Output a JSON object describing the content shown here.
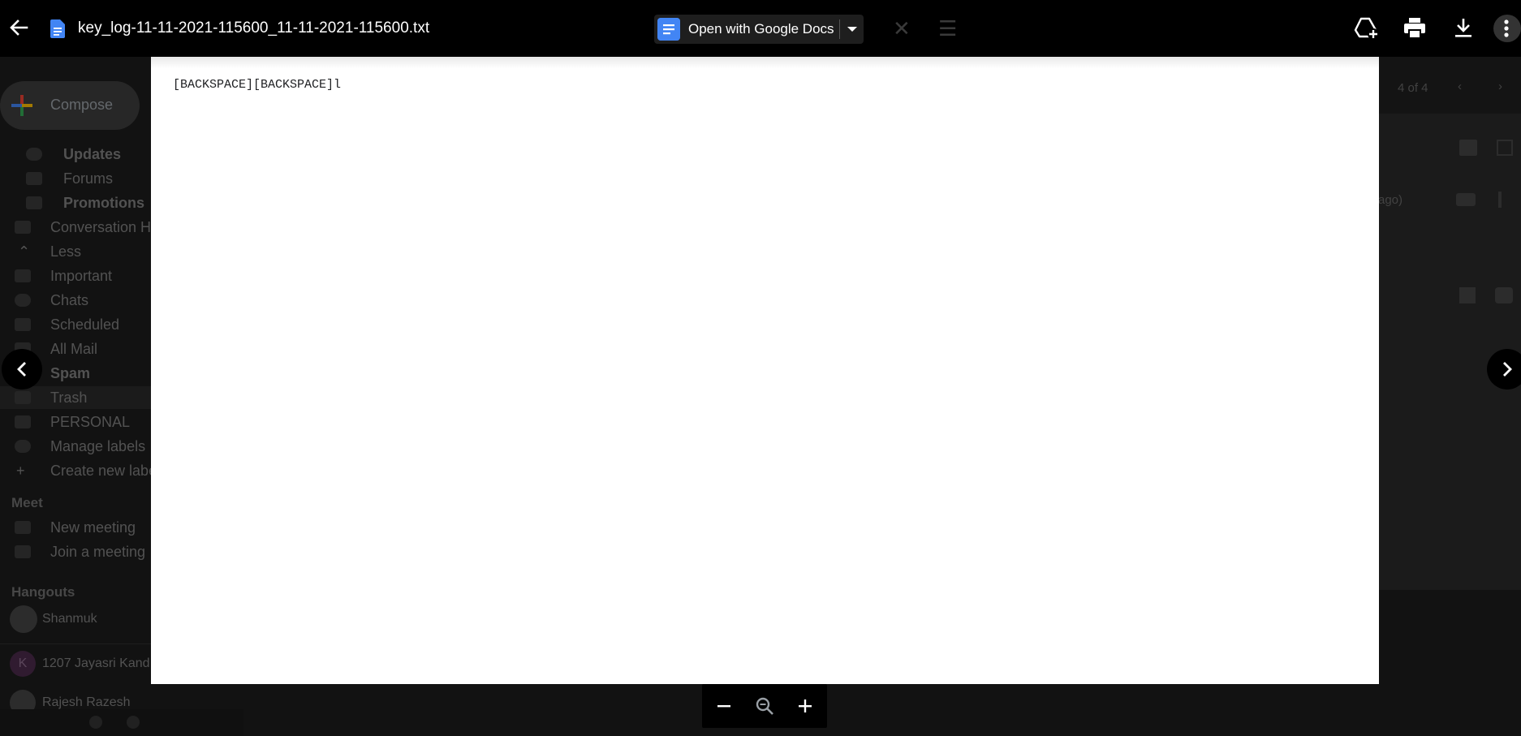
{
  "viewer": {
    "file_name": "key_log-11-11-2021-115600_11-11-2021-115600.txt",
    "open_with_label": "Open with Google Docs",
    "document_text": "[BACKSPACE][BACKSPACE]l"
  },
  "background_gmail": {
    "compose_label": "Compose",
    "nav_items": [
      {
        "label": "Updates",
        "bold": true
      },
      {
        "label": "Forums",
        "bold": false
      },
      {
        "label": "Promotions",
        "bold": true
      },
      {
        "label": "Conversation H",
        "bold": false
      },
      {
        "label": "Less",
        "bold": false
      },
      {
        "label": "Important",
        "bold": false
      },
      {
        "label": "Chats",
        "bold": false
      },
      {
        "label": "Scheduled",
        "bold": false
      },
      {
        "label": "All Mail",
        "bold": false
      },
      {
        "label": "Spam",
        "bold": true
      },
      {
        "label": "Trash",
        "bold": false
      },
      {
        "label": "PERSONAL",
        "bold": false
      },
      {
        "label": "Manage labels",
        "bold": false
      },
      {
        "label": "Create new labe",
        "bold": false
      }
    ],
    "meet_heading": "Meet",
    "meet_items": [
      "New meeting",
      "Join a meeting"
    ],
    "hangouts_heading": "Hangouts",
    "hangouts_user": "Shanmuk",
    "hangouts_contacts": [
      "1207 Jayasri Kand",
      "Rajesh Razesh"
    ],
    "contact_initial": "K",
    "pager": "4 of 4",
    "time_fragment": "ago)"
  },
  "colors": {
    "topbar": "#000000",
    "docs_blue": "#4285f4",
    "page": "#ffffff"
  },
  "icons": [
    "back-arrow-icon",
    "text-file-icon",
    "google-docs-icon",
    "dropdown-arrow-icon",
    "add-to-drive-icon",
    "print-icon",
    "download-icon",
    "more-vert-icon",
    "chevron-left-icon",
    "chevron-right-icon",
    "zoom-out-icon",
    "zoom-reset-icon",
    "zoom-in-icon"
  ]
}
